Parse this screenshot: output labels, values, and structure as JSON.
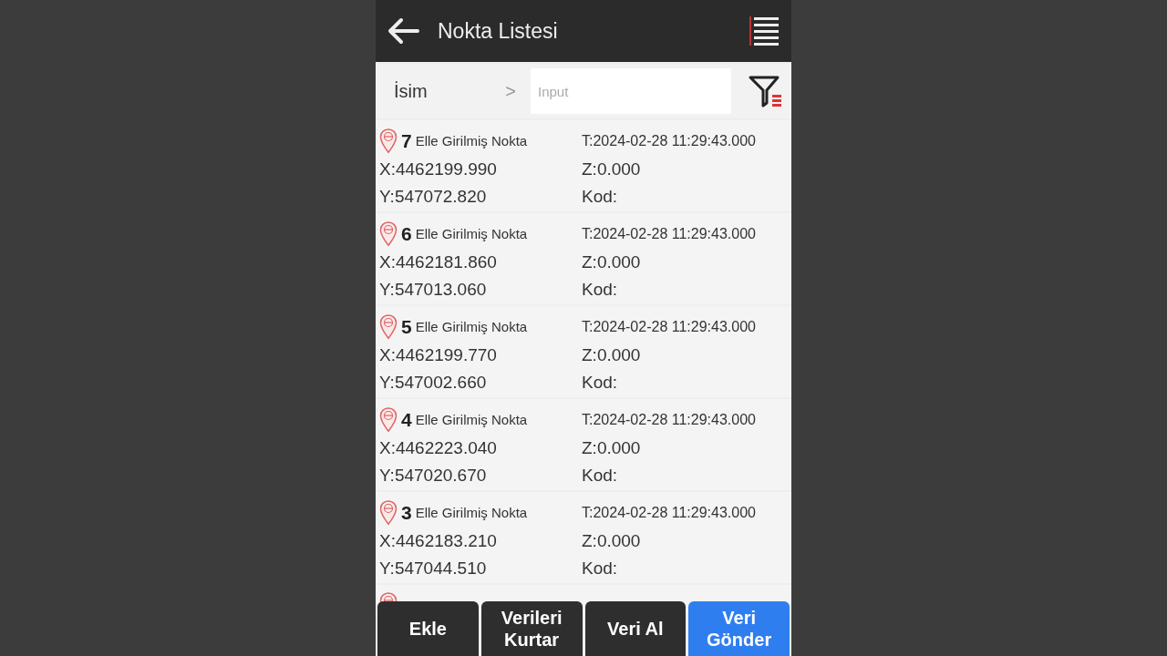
{
  "header": {
    "title": "Nokta Listesi"
  },
  "filter": {
    "field": "İsim",
    "chevron": ">",
    "placeholder": "Input"
  },
  "points": [
    {
      "number": "7",
      "name": "Elle Girilmiş Nokta",
      "x": "X:4462199.990",
      "y": "Y:547072.820",
      "t": "T:2024-02-28 11:29:43.000",
      "z": "Z:0.000",
      "kod": "Kod:"
    },
    {
      "number": "6",
      "name": "Elle Girilmiş Nokta",
      "x": "X:4462181.860",
      "y": "Y:547013.060",
      "t": "T:2024-02-28 11:29:43.000",
      "z": "Z:0.000",
      "kod": "Kod:"
    },
    {
      "number": "5",
      "name": "Elle Girilmiş Nokta",
      "x": "X:4462199.770",
      "y": "Y:547002.660",
      "t": "T:2024-02-28 11:29:43.000",
      "z": "Z:0.000",
      "kod": "Kod:"
    },
    {
      "number": "4",
      "name": "Elle Girilmiş Nokta",
      "x": "X:4462223.040",
      "y": "Y:547020.670",
      "t": "T:2024-02-28 11:29:43.000",
      "z": "Z:0.000",
      "kod": "Kod:"
    },
    {
      "number": "3",
      "name": "Elle Girilmiş Nokta",
      "x": "X:4462183.210",
      "y": "Y:547044.510",
      "t": "T:2024-02-28 11:29:43.000",
      "z": "Z:0.000",
      "kod": "Kod:"
    }
  ],
  "buttons": [
    {
      "label": "Ekle",
      "selected": false
    },
    {
      "label": "Verileri Kurtar",
      "selected": false
    },
    {
      "label": "Veri Al",
      "selected": false
    },
    {
      "label": "Veri Gönder",
      "selected": true
    }
  ]
}
